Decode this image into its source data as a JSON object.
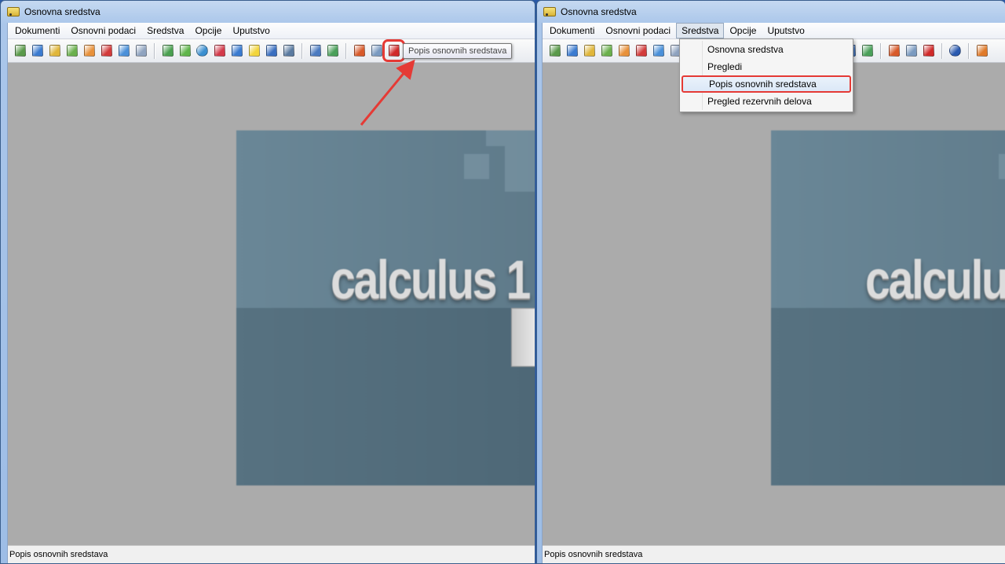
{
  "window_title": "Osnovna sredstva",
  "menu": [
    "Dokumenti",
    "Osnovni podaci",
    "Sredstva",
    "Opcije",
    "Uputstvo"
  ],
  "toolbar_icons": [
    {
      "name": "new-document-icon",
      "color": "#5a9a4a"
    },
    {
      "name": "open-document-icon",
      "color": "#3b7bd0"
    },
    {
      "name": "folder-document-icon",
      "color": "#e0b63a"
    },
    {
      "name": "add-document-icon",
      "color": "#6ab04c"
    },
    {
      "name": "edit-document-icon",
      "color": "#e8913a"
    },
    {
      "name": "delete-document-icon",
      "color": "#d23b3b"
    },
    {
      "name": "refresh-document-icon",
      "color": "#4a90d9"
    },
    {
      "name": "print-document-icon",
      "color": "#8fa3bf"
    },
    {
      "name": "org-tree-icon",
      "color": "#4aa050"
    },
    {
      "name": "user-icon",
      "color": "#5fb54a"
    },
    {
      "name": "globe-icon",
      "color": "#3a8fd0"
    },
    {
      "name": "gem-icon",
      "color": "#d33a4a"
    },
    {
      "name": "hierarchy-icon",
      "color": "#3a7bd0"
    },
    {
      "name": "lightbulb-icon",
      "color": "#f2d53c"
    },
    {
      "name": "info-icon",
      "color": "#3a6fc0"
    },
    {
      "name": "share-icon",
      "color": "#5a7aa0"
    },
    {
      "name": "grid-report-icon",
      "color": "#4a7ac0"
    },
    {
      "name": "export-report-icon",
      "color": "#4aa05a"
    },
    {
      "name": "house-icon",
      "color": "#d85a2a"
    },
    {
      "name": "search-report-icon",
      "color": "#7a9ac0"
    },
    {
      "name": "asset-list-icon",
      "color": "#d02a2a"
    },
    {
      "name": "help-icon",
      "color": "#2a5ab0"
    },
    {
      "name": "exit-icon",
      "color": "#e07a2a"
    }
  ],
  "tooltip": "Popis osnovnih sredstava",
  "status_text": "Popis osnovnih sredstava",
  "banner_text": "calculus 1",
  "dropdown_items": [
    "Osnovna sredstva",
    "Pregledi",
    "Popis osnovnih sredstava",
    "Pregled rezervnih delova"
  ],
  "highlight_color": "#e53a35"
}
